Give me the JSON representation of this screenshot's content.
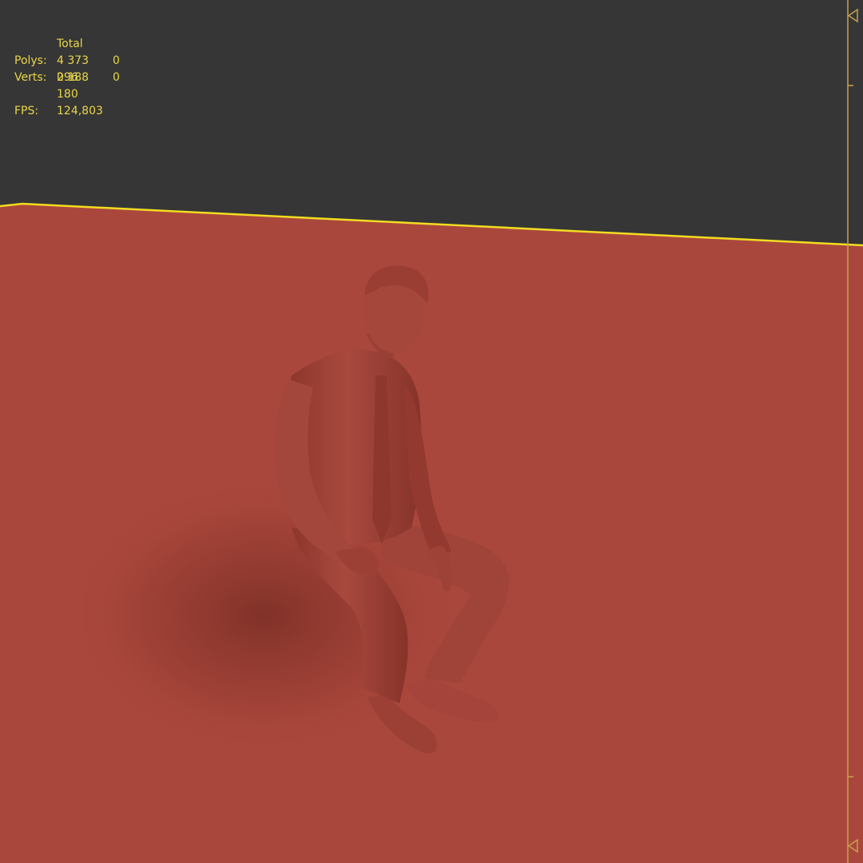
{
  "viewport": {
    "background_color": "#363636",
    "ground_color": "#aa473c",
    "highlight_color": "#f2dc22",
    "model_color": "#a6473c",
    "model_subject": "seated man in shirt and tie"
  },
  "stats": {
    "header": "Total",
    "polys_label": "Polys:",
    "polys_total": "4 373 096",
    "polys_selected": "0",
    "verts_label": "Verts:",
    "verts_total": "2 188 180",
    "verts_selected": "0",
    "fps_label": "FPS:",
    "fps_value": "124,803"
  },
  "icons": {
    "time_slider_top": "triangle-marker-icon",
    "time_slider_bottom": "triangle-marker-icon"
  }
}
